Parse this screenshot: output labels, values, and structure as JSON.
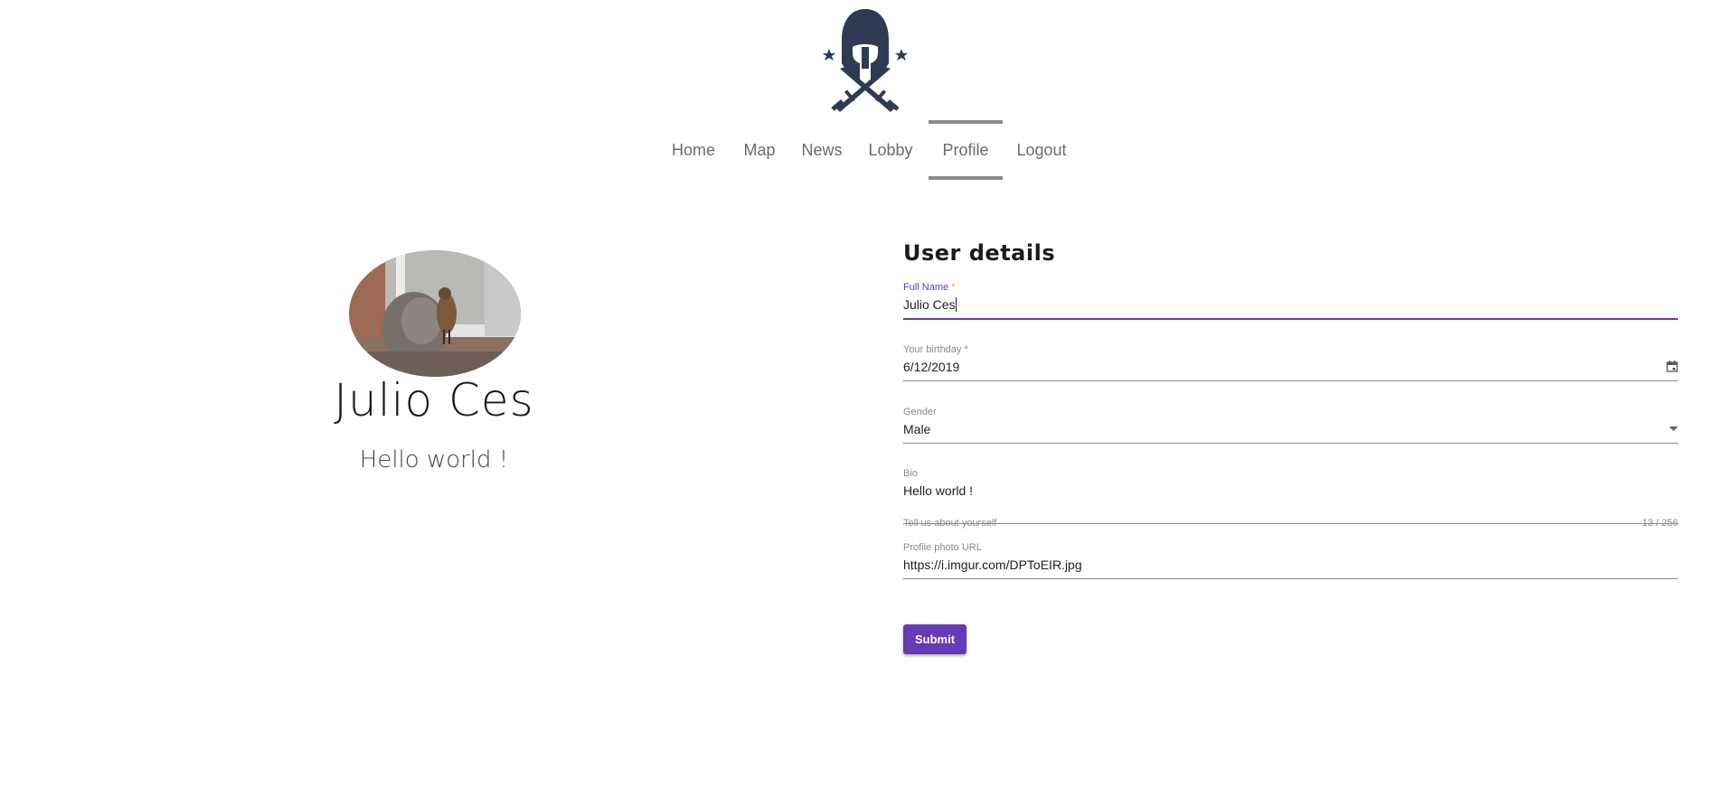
{
  "nav": {
    "items": [
      {
        "label": "Home"
      },
      {
        "label": "Map"
      },
      {
        "label": "News"
      },
      {
        "label": "Lobby"
      },
      {
        "label": "Profile",
        "active": true
      },
      {
        "label": "Logout"
      }
    ]
  },
  "profile": {
    "name": "Julio Ces",
    "bio": "Hello world !"
  },
  "form": {
    "title": "User details",
    "full_name": {
      "label": "Full Name",
      "required_mark": "*",
      "value": "Julio Ces"
    },
    "birthday": {
      "label": "Your birthday",
      "required_mark": "*",
      "value": "6/12/2019"
    },
    "gender": {
      "label": "Gender",
      "value": "Male"
    },
    "bio": {
      "label": "Bio",
      "value": "Hello world !",
      "hint": "Tell us about yourself",
      "counter": "13 / 256"
    },
    "photo_url": {
      "label": "Profile photo URL",
      "value": "https://i.imgur.com/DPToEIR.jpg"
    },
    "submit_label": "Submit"
  },
  "colors": {
    "accent": "#673ab7",
    "logo": "#2f3b52",
    "required_focused": "#ffb300"
  },
  "icons": {
    "logo": "spartan-helmet-crossed-swords-logo",
    "date": "calendar-icon",
    "dropdown": "dropdown-arrow-icon"
  }
}
